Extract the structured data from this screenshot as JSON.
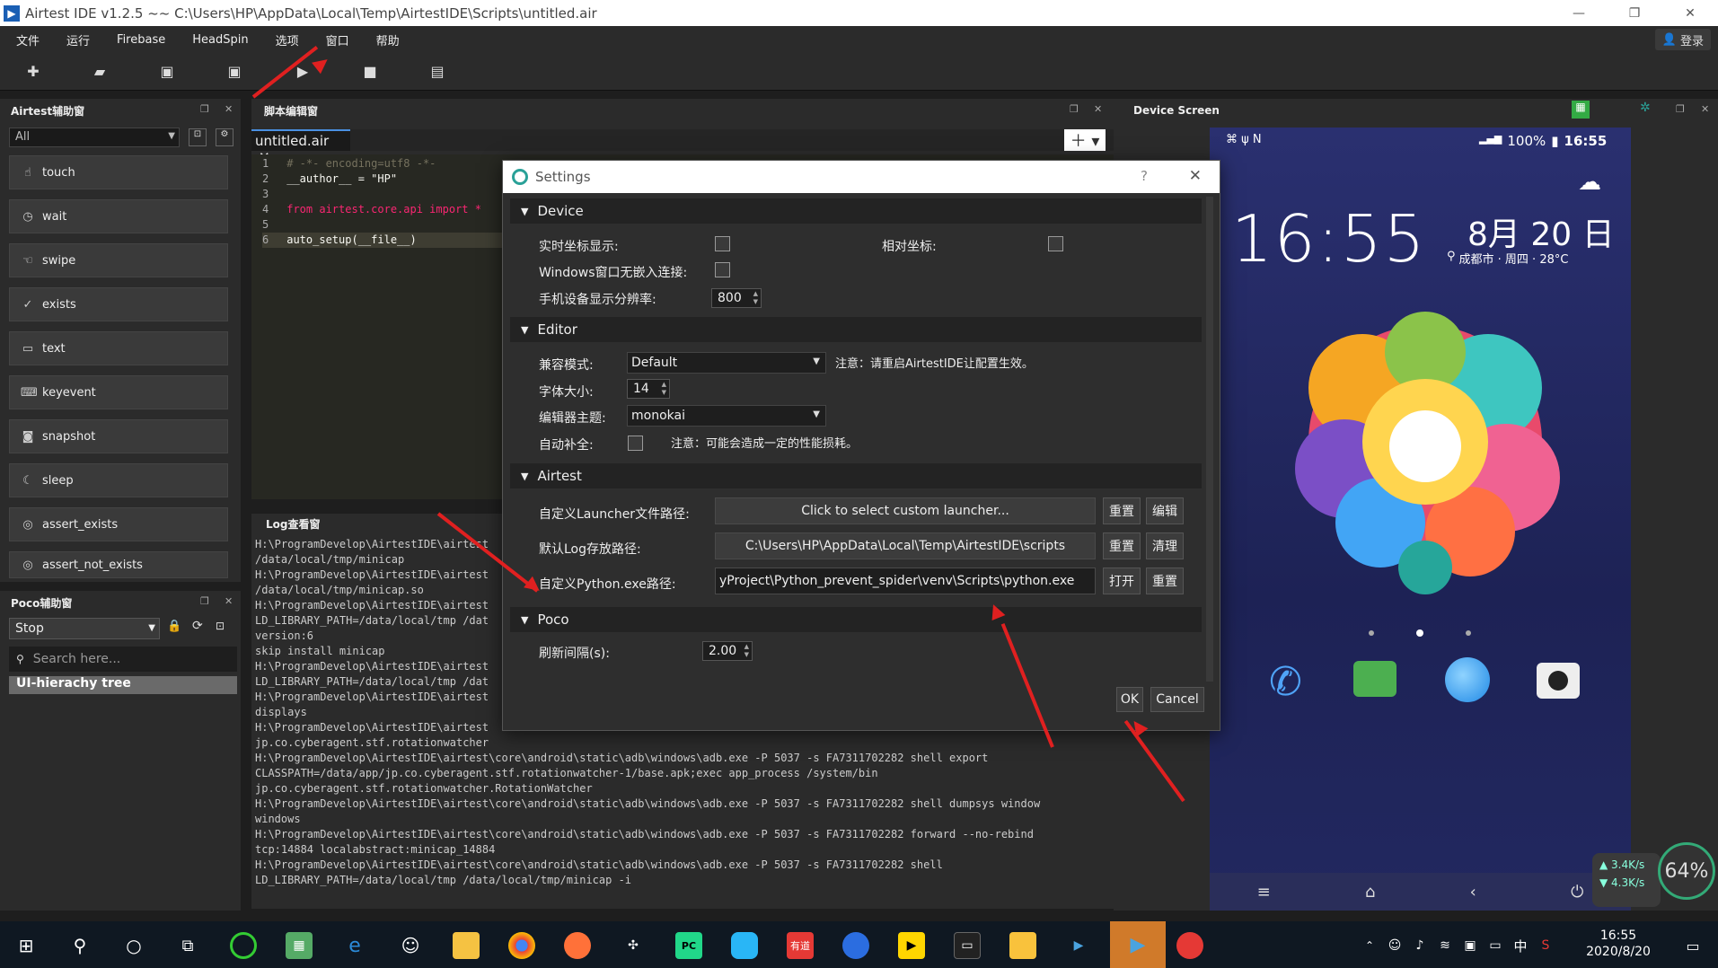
{
  "window": {
    "title": "Airtest IDE v1.2.5 ~~ C:\\Users\\HP\\AppData\\Local\\Temp\\AirtestIDE\\Scripts\\untitled.air",
    "minimize": "—",
    "maximize": "❐",
    "close": "✕"
  },
  "menu": [
    "文件",
    "运行",
    "Firebase",
    "HeadSpin",
    "选项",
    "窗口",
    "帮助"
  ],
  "login_label": "登录",
  "airtest_helper": {
    "title": "Airtest辅助窗",
    "filter": "All",
    "items": [
      "touch",
      "wait",
      "swipe",
      "exists",
      "text",
      "keyevent",
      "snapshot",
      "sleep",
      "assert_exists",
      "assert_not_exists"
    ]
  },
  "poco_helper": {
    "title": "Poco辅助窗",
    "mode": "Stop",
    "search_placeholder": "Search here...",
    "tree_label": "UI-hierachy tree"
  },
  "editor": {
    "title": "脚本编辑窗",
    "tab": "untitled.air",
    "lines": [
      {
        "n": "1",
        "t": "# -*- encoding=utf8 -*-"
      },
      {
        "n": "2",
        "t": "__author__ = \"HP\""
      },
      {
        "n": "3",
        "t": ""
      },
      {
        "n": "4",
        "t": "from airtest.core.api import *"
      },
      {
        "n": "5",
        "t": ""
      },
      {
        "n": "6",
        "t": "auto_setup(__file__)"
      }
    ]
  },
  "log": {
    "title": "Log查看窗",
    "lines": [
      "H:\\ProgramDevelop\\AirtestIDE\\airtest",
      "/data/local/tmp/minicap",
      "H:\\ProgramDevelop\\AirtestIDE\\airtest",
      "/data/local/tmp/minicap.so",
      "H:\\ProgramDevelop\\AirtestIDE\\airtest",
      "LD_LIBRARY_PATH=/data/local/tmp /dat",
      "version:6",
      "skip install minicap",
      "H:\\ProgramDevelop\\AirtestIDE\\airtest",
      "LD_LIBRARY_PATH=/data/local/tmp /dat",
      "H:\\ProgramDevelop\\AirtestIDE\\airtest",
      "displays",
      "H:\\ProgramDevelop\\AirtestIDE\\airtest",
      "jp.co.cyberagent.stf.rotationwatcher",
      "H:\\ProgramDevelop\\AirtestIDE\\airtest\\core\\android\\static\\adb\\windows\\adb.exe -P 5037 -s FA7311702282 shell export",
      "CLASSPATH=/data/app/jp.co.cyberagent.stf.rotationwatcher-1/base.apk;exec app_process /system/bin",
      "jp.co.cyberagent.stf.rotationwatcher.RotationWatcher",
      "H:\\ProgramDevelop\\AirtestIDE\\airtest\\core\\android\\static\\adb\\windows\\adb.exe -P 5037 -s FA7311702282 shell dumpsys window",
      "windows",
      "H:\\ProgramDevelop\\AirtestIDE\\airtest\\core\\android\\static\\adb\\windows\\adb.exe -P 5037 -s FA7311702282 forward --no-rebind",
      "tcp:14884 localabstract:minicap_14884",
      "H:\\ProgramDevelop\\AirtestIDE\\airtest\\core\\android\\static\\adb\\windows\\adb.exe -P 5037 -s FA7311702282 shell",
      "LD_LIBRARY_PATH=/data/local/tmp /data/local/tmp/minicap -i"
    ]
  },
  "settings": {
    "title": "Settings",
    "help": "?",
    "close": "✕",
    "device": {
      "header": "Device",
      "realtime_coord": "实时坐标显示:",
      "relative_coord": "相对坐标:",
      "windows_embed": "Windows窗口无嵌入连接:",
      "resolution_label": "手机设备显示分辨率:",
      "resolution": "800"
    },
    "editor": {
      "header": "Editor",
      "compat_label": "兼容模式:",
      "compat_value": "Default",
      "compat_note": "注意：请重启AirtestIDE让配置生效。",
      "fontsize_label": "字体大小:",
      "fontsize": "14",
      "theme_label": "编辑器主题:",
      "theme": "monokai",
      "autocomplete_label": "自动补全:",
      "autocomplete_note": "注意：可能会造成一定的性能损耗。"
    },
    "airtest": {
      "header": "Airtest",
      "launcher_label": "自定义Launcher文件路径:",
      "launcher_value": "Click to select custom launcher...",
      "log_label": "默认Log存放路径:",
      "log_value": "C:\\Users\\HP\\AppData\\Local\\Temp\\AirtestIDE\\scripts",
      "python_label": "自定义Python.exe路径:",
      "python_value": "yProject\\Python_prevent_spider\\venv\\Scripts\\python.exe",
      "reset": "重置",
      "edit": "编辑",
      "clear": "清理",
      "open": "打开"
    },
    "poco": {
      "header": "Poco",
      "interval_label": "刷新间隔(s):",
      "interval": "2.00"
    },
    "ok": "OK",
    "cancel": "Cancel"
  },
  "device_screen": {
    "title": "Device Screen",
    "status_battery": "100%",
    "status_time": "16:55",
    "clock": "16:55",
    "date": "8月 20 日",
    "weather_line": "成都市 · 周四 · 28°C"
  },
  "netspeed": {
    "up": "3.4K/s",
    "down": "4.3K/s",
    "percent": "64%"
  },
  "taskbar": {
    "time": "16:55",
    "date": "2020/8/20",
    "ime": "中"
  }
}
